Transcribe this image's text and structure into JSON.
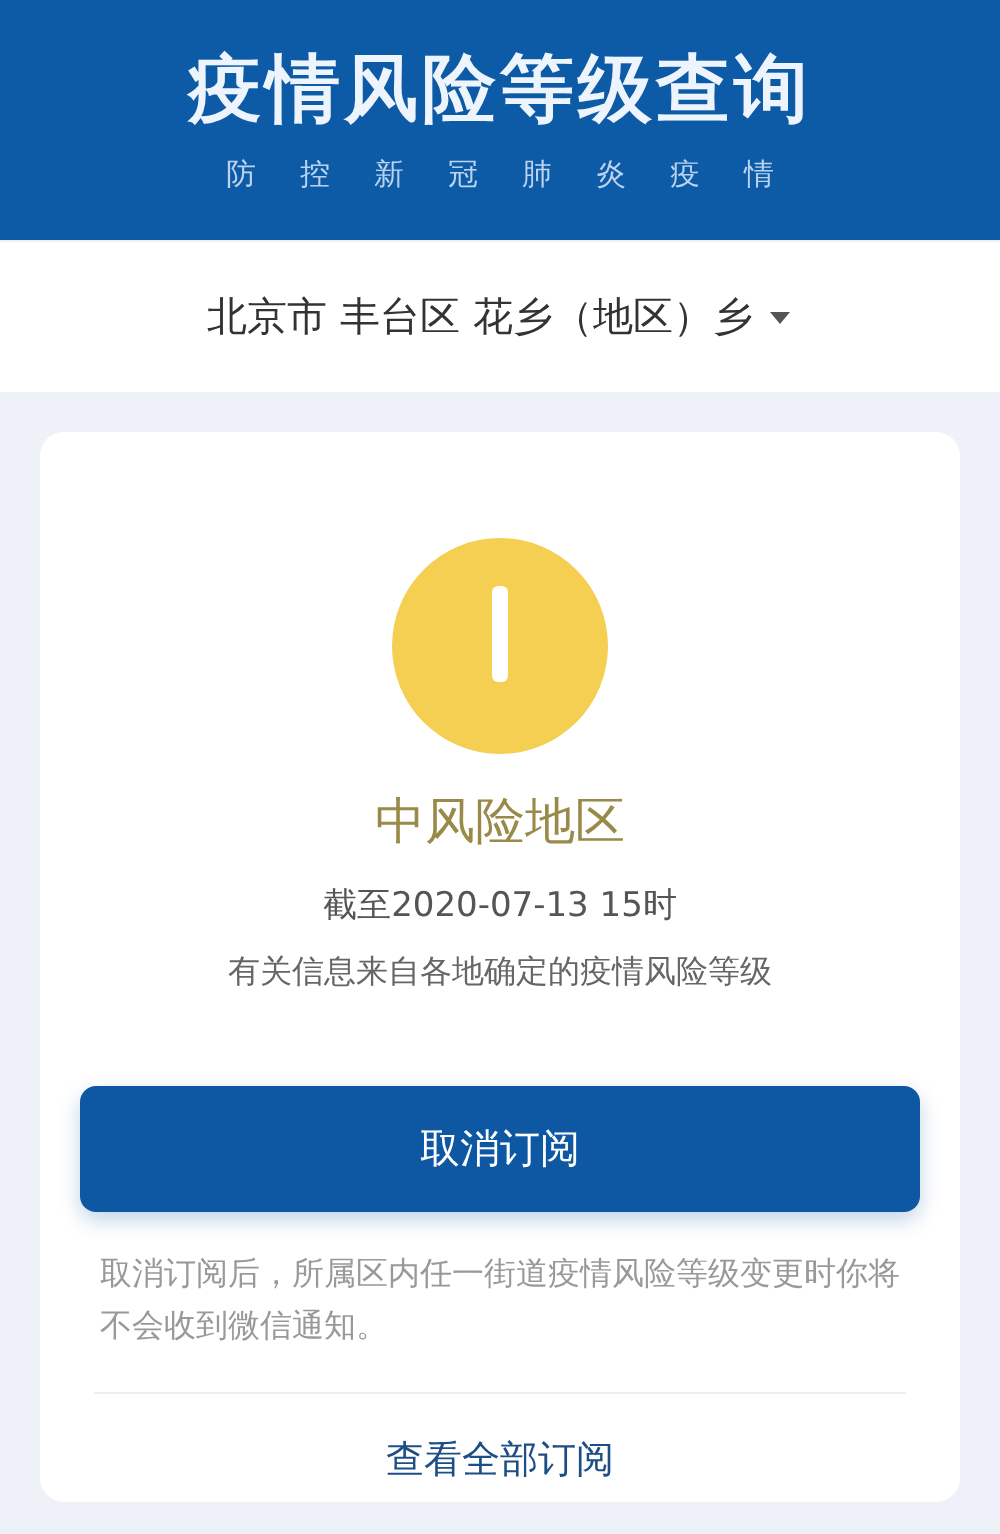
{
  "header": {
    "title": "疫情风险等级查询",
    "subtitle": [
      "防",
      "控",
      "新",
      "冠",
      "肺",
      "炎",
      "疫",
      "情"
    ]
  },
  "region": {
    "label": "北京市 丰台区 花乡（地区）乡"
  },
  "result": {
    "kind": "medium",
    "label": "中风险地区",
    "updated": "截至2020-07-13 15时",
    "source": "有关信息来自各地确定的疫情风险等级"
  },
  "unsubscribe_button": "取消订阅",
  "note": "取消订阅后，所属区内任一街道疫情风险等级变更时你将不会收到微信通知。",
  "view_all_link": "查看全部订阅"
}
